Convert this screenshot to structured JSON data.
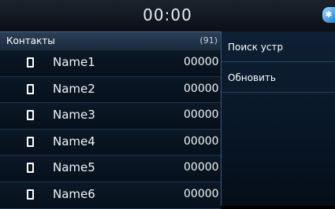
{
  "status_bar": {
    "clock": "00:00",
    "bluetooth_icon": "bluetooth-icon"
  },
  "contacts": {
    "title": "Контакты",
    "count": "(91)",
    "items": [
      {
        "name": "Name1",
        "number": "00000",
        "icon": "phone-icon"
      },
      {
        "name": "Name2",
        "number": "00000",
        "icon": "phone-icon"
      },
      {
        "name": "Name3",
        "number": "00000",
        "icon": "phone-icon"
      },
      {
        "name": "Name4",
        "number": "00000",
        "icon": "phone-icon"
      },
      {
        "name": "Name5",
        "number": "00000",
        "icon": "phone-icon"
      },
      {
        "name": "Name6",
        "number": "00000",
        "icon": "phone-icon"
      }
    ]
  },
  "menu": {
    "items": [
      {
        "label": "Поиск устр"
      },
      {
        "label": "Обновить"
      }
    ]
  },
  "colors": {
    "background": "#000000",
    "accent_blue": "#1e7fd6",
    "row_divider": "#1e3550"
  }
}
